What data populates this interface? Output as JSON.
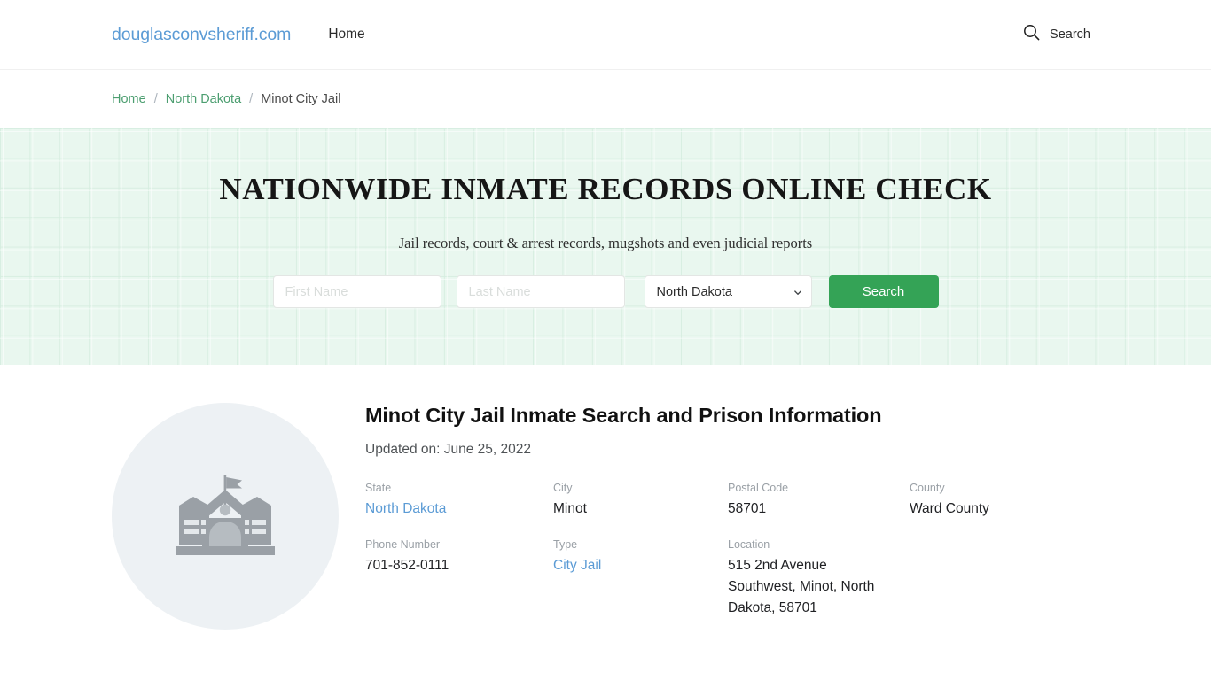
{
  "header": {
    "brand": "douglasconvsheriff.com",
    "nav": [
      {
        "label": "Home"
      }
    ],
    "search_label": "Search",
    "search_icon": "magnifier-icon"
  },
  "breadcrumb": {
    "separator": "/",
    "items": [
      {
        "label": "Home",
        "type": "link"
      },
      {
        "label": "North Dakota",
        "type": "link"
      },
      {
        "label": "Minot City Jail",
        "type": "current"
      }
    ]
  },
  "hero": {
    "title": "NATIONWIDE INMATE RECORDS ONLINE CHECK",
    "subtitle": "Jail records, court & arrest records, mugshots and even judicial reports",
    "form": {
      "first_name_placeholder": "First Name",
      "first_name_value": "",
      "last_name_placeholder": "Last Name",
      "last_name_value": "",
      "state_selected": "North Dakota",
      "state_options": [
        "North Dakota"
      ],
      "submit_label": "Search",
      "submit_color": "#34a356"
    }
  },
  "main": {
    "thumbnail_icon": "institution-building-icon",
    "title": "Minot City Jail Inmate Search and Prison Information",
    "updated": "Updated on: June 25, 2022",
    "fields": [
      {
        "label": "State",
        "value": "North Dakota",
        "link": true
      },
      {
        "label": "City",
        "value": "Minot",
        "link": false
      },
      {
        "label": "Postal Code",
        "value": "58701",
        "link": false
      },
      {
        "label": "County",
        "value": "Ward County",
        "link": false
      },
      {
        "label": "Phone Number",
        "value": "701-852-0111",
        "link": false
      },
      {
        "label": "Type",
        "value": "City Jail",
        "link": true
      },
      {
        "label": "Location",
        "value": "515 2nd Avenue Southwest, Minot, North Dakota, 58701",
        "link": false
      }
    ]
  }
}
